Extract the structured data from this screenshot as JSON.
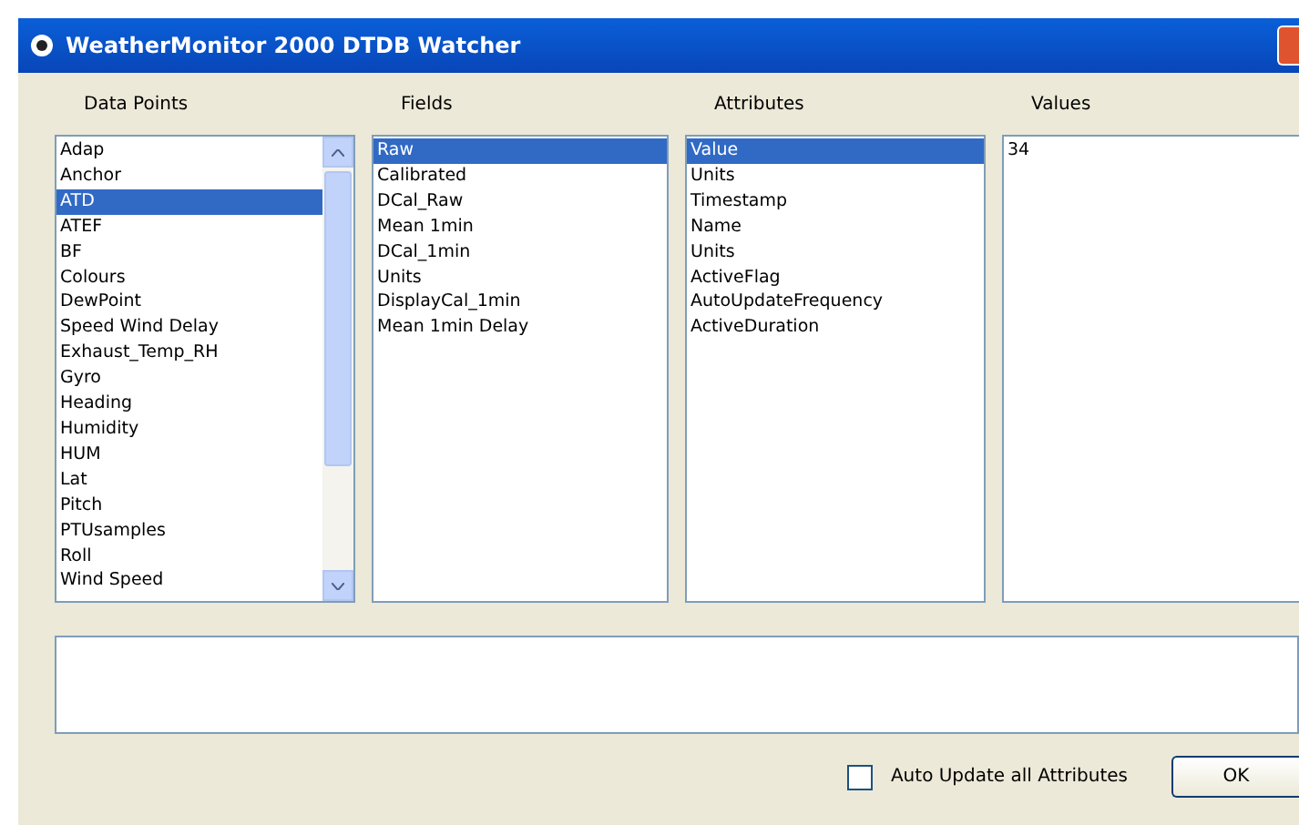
{
  "window": {
    "title": "WeatherMonitor 2000 DTDB Watcher"
  },
  "columns": [
    {
      "heading": "Data Points",
      "scrollbar": true,
      "items": [
        {
          "label": "Adap",
          "selected": false
        },
        {
          "label": "Anchor",
          "selected": false
        },
        {
          "label": "ATD",
          "selected": true
        },
        {
          "label": "ATEF",
          "selected": false
        },
        {
          "label": "BF",
          "selected": false
        },
        {
          "label": "Colours",
          "selected": false
        },
        {
          "label": "DewPoint",
          "selected": false
        },
        {
          "label": "Speed Wind Delay",
          "selected": false
        },
        {
          "label": "Exhaust_Temp_RH",
          "selected": false
        },
        {
          "label": "Gyro",
          "selected": false
        },
        {
          "label": "Heading",
          "selected": false
        },
        {
          "label": "Humidity",
          "selected": false
        },
        {
          "label": "HUM",
          "selected": false
        },
        {
          "label": "Lat",
          "selected": false
        },
        {
          "label": "Pitch",
          "selected": false
        },
        {
          "label": "PTUsamples",
          "selected": false
        },
        {
          "label": "Roll",
          "selected": false
        },
        {
          "label": "Wind Speed",
          "selected": false
        }
      ]
    },
    {
      "heading": "Fields",
      "scrollbar": false,
      "items": [
        {
          "label": "Raw",
          "selected": true
        },
        {
          "label": "Calibrated",
          "selected": false
        },
        {
          "label": "DCal_Raw",
          "selected": false
        },
        {
          "label": "Mean 1min",
          "selected": false
        },
        {
          "label": "DCal_1min",
          "selected": false
        },
        {
          "label": "Units",
          "selected": false
        },
        {
          "label": "DisplayCal_1min",
          "selected": false
        },
        {
          "label": "Mean 1min Delay",
          "selected": false
        }
      ]
    },
    {
      "heading": "Attributes",
      "scrollbar": false,
      "items": [
        {
          "label": "Value",
          "selected": true
        },
        {
          "label": "Units",
          "selected": false
        },
        {
          "label": "Timestamp",
          "selected": false
        },
        {
          "label": "Name",
          "selected": false
        },
        {
          "label": "Units",
          "selected": false
        },
        {
          "label": "ActiveFlag",
          "selected": false
        },
        {
          "label": "AutoUpdateFrequency",
          "selected": false
        },
        {
          "label": "ActiveDuration",
          "selected": false
        }
      ]
    },
    {
      "heading": "Values",
      "scrollbar": false,
      "items": [
        {
          "label": "34",
          "selected": false
        }
      ]
    }
  ],
  "auto_update": {
    "label": "Auto Update all Attributes",
    "checked": false
  },
  "ok_button": "OK"
}
